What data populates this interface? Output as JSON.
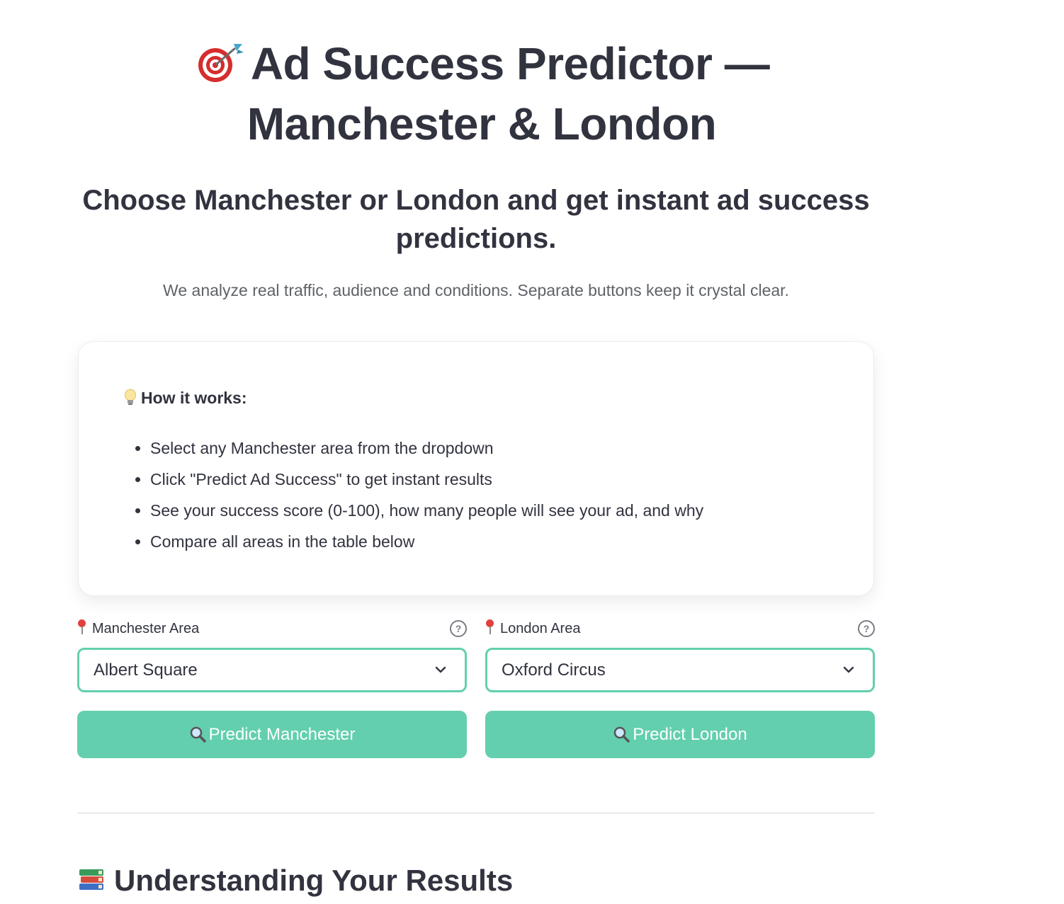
{
  "header": {
    "title_line1": "Ad Success Predictor —",
    "title_line2": "Manchester & London",
    "subtitle": "Choose Manchester or London and get instant ad success predictions.",
    "tagline": "We analyze real traffic, audience and conditions. Separate buttons keep it crystal clear."
  },
  "how_it_works": {
    "title": "How it works:",
    "items": [
      "Select any Manchester area from the dropdown",
      "Click \"Predict Ad Success\" to get instant results",
      "See your success score (0-100), how many people will see your ad, and why",
      "Compare all areas in the table below"
    ]
  },
  "manchester": {
    "label": "Manchester Area",
    "selected": "Albert Square",
    "button_label": "Predict Manchester"
  },
  "london": {
    "label": "London Area",
    "selected": "Oxford Circus",
    "button_label": "Predict London"
  },
  "results": {
    "title": "Understanding Your Results"
  },
  "colors": {
    "accent": "#63cfae",
    "text": "#31333f",
    "muted": "#5f6368"
  },
  "icons": [
    "dartboard-icon",
    "lightbulb-icon",
    "pin-icon",
    "help-icon",
    "chevron-down-icon",
    "magnifier-icon",
    "books-icon"
  ]
}
